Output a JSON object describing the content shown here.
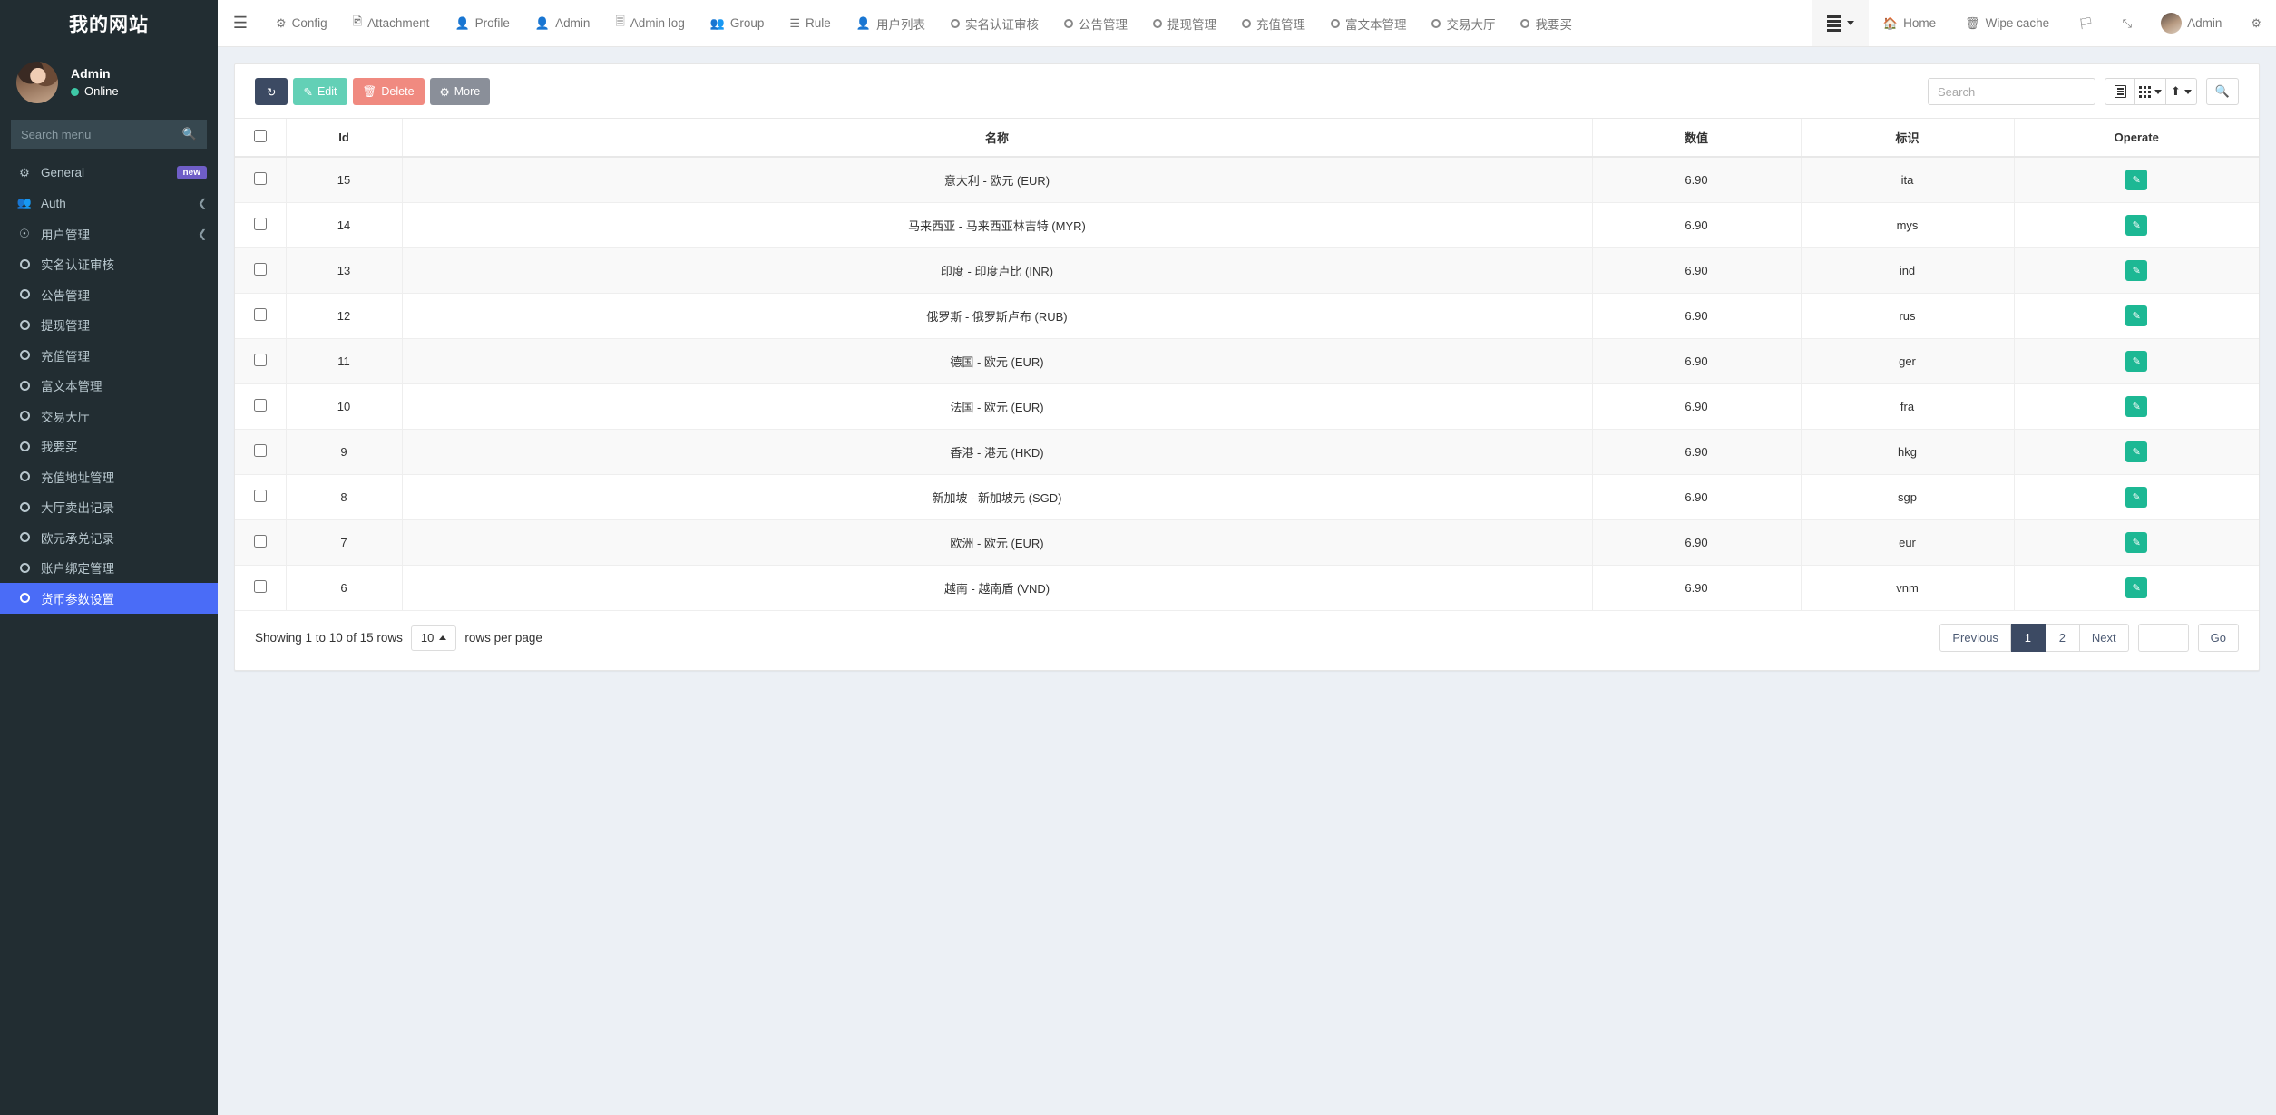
{
  "sidebar": {
    "brand": "我的网站",
    "user": {
      "name": "Admin",
      "status": "Online"
    },
    "search_placeholder": "Search menu",
    "items": [
      {
        "label": "General",
        "icon": "gears-icon",
        "badge": "new",
        "chevron": false,
        "active": false
      },
      {
        "label": "Auth",
        "icon": "users-icon",
        "badge": "",
        "chevron": true,
        "active": false
      },
      {
        "label": "用户管理",
        "icon": "user-circle-icon",
        "badge": "",
        "chevron": true,
        "active": false
      },
      {
        "label": "实名认证审核",
        "icon": "circle-o-icon",
        "badge": "",
        "chevron": false,
        "active": false
      },
      {
        "label": "公告管理",
        "icon": "circle-o-icon",
        "badge": "",
        "chevron": false,
        "active": false
      },
      {
        "label": "提现管理",
        "icon": "circle-o-icon",
        "badge": "",
        "chevron": false,
        "active": false
      },
      {
        "label": "充值管理",
        "icon": "circle-o-icon",
        "badge": "",
        "chevron": false,
        "active": false
      },
      {
        "label": "富文本管理",
        "icon": "circle-o-icon",
        "badge": "",
        "chevron": false,
        "active": false
      },
      {
        "label": "交易大厅",
        "icon": "circle-o-icon",
        "badge": "",
        "chevron": false,
        "active": false
      },
      {
        "label": "我要买",
        "icon": "circle-o-icon",
        "badge": "",
        "chevron": false,
        "active": false
      },
      {
        "label": "充值地址管理",
        "icon": "circle-o-icon",
        "badge": "",
        "chevron": false,
        "active": false
      },
      {
        "label": "大厅卖出记录",
        "icon": "circle-o-icon",
        "badge": "",
        "chevron": false,
        "active": false
      },
      {
        "label": "欧元承兑记录",
        "icon": "circle-o-icon",
        "badge": "",
        "chevron": false,
        "active": false
      },
      {
        "label": "账户绑定管理",
        "icon": "circle-o-icon",
        "badge": "",
        "chevron": false,
        "active": false
      },
      {
        "label": "货币参数设置",
        "icon": "circle-o-icon",
        "badge": "",
        "chevron": false,
        "active": true
      }
    ]
  },
  "topnav": {
    "menu_toggle_icon": "hamburger-icon",
    "tabs": [
      {
        "label": "Config",
        "icon": "gear-icon"
      },
      {
        "label": "Attachment",
        "icon": "image-file-icon"
      },
      {
        "label": "Profile",
        "icon": "user-icon"
      },
      {
        "label": "Admin",
        "icon": "user-icon"
      },
      {
        "label": "Admin log",
        "icon": "list-alt-icon"
      },
      {
        "label": "Group",
        "icon": "users-icon"
      },
      {
        "label": "Rule",
        "icon": "bars-icon"
      },
      {
        "label": "用户列表",
        "icon": "user-icon"
      },
      {
        "label": "实名认证审核",
        "icon": "circle-o-icon"
      },
      {
        "label": "公告管理",
        "icon": "circle-o-icon"
      },
      {
        "label": "提现管理",
        "icon": "circle-o-icon"
      },
      {
        "label": "充值管理",
        "icon": "circle-o-icon"
      },
      {
        "label": "富文本管理",
        "icon": "circle-o-icon"
      },
      {
        "label": "交易大厅",
        "icon": "circle-o-icon"
      },
      {
        "label": "我要买",
        "icon": "circle-o-icon"
      }
    ],
    "right": {
      "tab_list_icon": "bars-dropdown-icon",
      "home": "Home",
      "home_icon": "home-icon",
      "wipe_cache": "Wipe cache",
      "wipe_cache_icon": "trash-icon",
      "lang_icon": "language-flag-icon",
      "fullscreen_icon": "expand-arrows-icon",
      "user_label": "Admin",
      "user_avatar_icon": "avatar-icon",
      "settings_icon": "gears-icon"
    }
  },
  "toolbar": {
    "refresh_icon": "refresh-icon",
    "edit_label": "Edit",
    "edit_icon": "pencil-icon",
    "delete_label": "Delete",
    "delete_icon": "trash-icon",
    "more_label": "More",
    "more_icon": "gear-icon",
    "search_placeholder": "Search",
    "search_value": "",
    "toggle_view_icon": "list-alt-icon",
    "columns_icon": "grid-dots-icon",
    "export_icon": "export-icon",
    "search_submit_icon": "search-icon",
    "colors": {
      "refresh": "#3c4a63",
      "edit": "#63d0b6",
      "delete": "#f08a80",
      "more": "#8a8f99",
      "operate": "#1db894",
      "active_menu": "#4a6cf7"
    }
  },
  "table": {
    "columns": [
      "",
      "Id",
      "名称",
      "数值",
      "标识",
      "Operate"
    ],
    "operate_icon": "pencil-icon",
    "rows": [
      {
        "id": "15",
        "name": "意大利 - 欧元 (EUR)",
        "value": "6.90",
        "flag": "ita"
      },
      {
        "id": "14",
        "name": "马来西亚 - 马来西亚林吉特 (MYR)",
        "value": "6.90",
        "flag": "mys"
      },
      {
        "id": "13",
        "name": "印度 - 印度卢比 (INR)",
        "value": "6.90",
        "flag": "ind"
      },
      {
        "id": "12",
        "name": "俄罗斯 - 俄罗斯卢布 (RUB)",
        "value": "6.90",
        "flag": "rus"
      },
      {
        "id": "11",
        "name": "德国 - 欧元 (EUR)",
        "value": "6.90",
        "flag": "ger"
      },
      {
        "id": "10",
        "name": "法国 - 欧元 (EUR)",
        "value": "6.90",
        "flag": "fra"
      },
      {
        "id": "9",
        "name": "香港 - 港元 (HKD)",
        "value": "6.90",
        "flag": "hkg"
      },
      {
        "id": "8",
        "name": "新加坡 - 新加坡元 (SGD)",
        "value": "6.90",
        "flag": "sgp"
      },
      {
        "id": "7",
        "name": "欧洲 - 欧元 (EUR)",
        "value": "6.90",
        "flag": "eur"
      },
      {
        "id": "6",
        "name": "越南 - 越南盾 (VND)",
        "value": "6.90",
        "flag": "vnm"
      }
    ]
  },
  "footer": {
    "showing_text": "Showing 1 to 10 of 15 rows",
    "rows_per_page_value": "10",
    "rows_per_page_label": "rows per page",
    "previous": "Previous",
    "pages": [
      "1",
      "2"
    ],
    "active_page": "1",
    "next": "Next",
    "goto_value": "",
    "go_label": "Go"
  }
}
